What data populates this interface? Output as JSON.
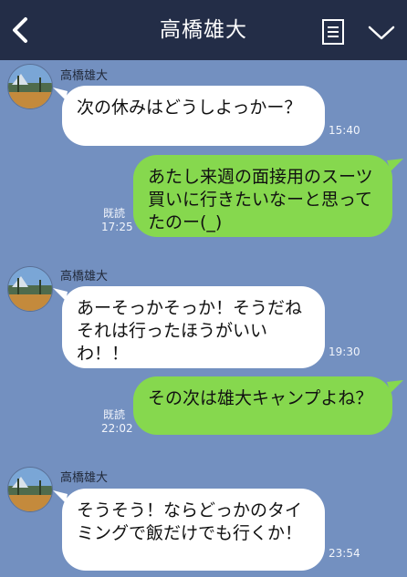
{
  "header": {
    "title": "高橋雄大",
    "back_icon": "chevron-left-icon",
    "note_icon": "note-icon",
    "menu_icon": "chevron-down-icon"
  },
  "colors": {
    "header_bg": "#232d47",
    "chat_bg": "#7390c0",
    "incoming_bubble": "#ffffff",
    "outgoing_bubble": "#86d84e"
  },
  "messages": [
    {
      "direction": "in",
      "sender": "高橋雄大",
      "text": "次の休みはどうしよっかー？",
      "time": "15:40"
    },
    {
      "direction": "out",
      "text": "あたし来週の面接用のスーツ買いに行きたいなーと思ってたのー(_)",
      "read": "既読",
      "time": "17:25"
    },
    {
      "direction": "in",
      "sender": "高橋雄大",
      "text": "あーそっかそっか！そうだねそれは行ったほうがいいわ！！",
      "time": "19:30"
    },
    {
      "direction": "out",
      "text": "その次は雄大キャンプよね？",
      "read": "既読",
      "time": "22:02"
    },
    {
      "direction": "in",
      "sender": "高橋雄大",
      "text": "そうそう！ならどっかのタイミングで飯だけでも行くか！",
      "time": "23:54"
    }
  ]
}
